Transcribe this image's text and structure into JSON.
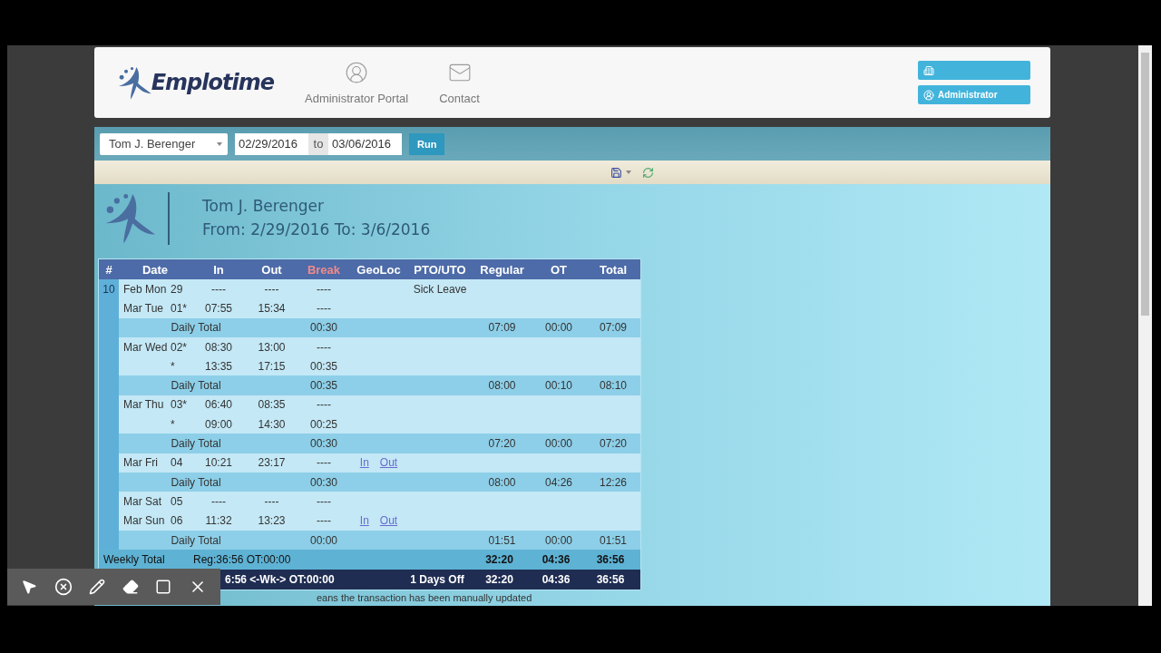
{
  "header": {
    "logo": "Emplotime",
    "nav": [
      {
        "label": "Administrator Portal"
      },
      {
        "label": "Contact"
      }
    ],
    "account_button": "Administrator"
  },
  "filter": {
    "employee": "Tom J. Berenger",
    "from": "02/29/2016",
    "to_label": "to",
    "to": "03/06/2016",
    "run": "Run"
  },
  "report": {
    "employee": "Tom J. Berenger",
    "range": "From: 2/29/2016 To: 3/6/2016"
  },
  "table": {
    "columns": [
      {
        "label": "#",
        "highlight": false
      },
      {
        "label": "Date",
        "highlight": false
      },
      {
        "label": "In",
        "highlight": false
      },
      {
        "label": "Out",
        "highlight": false
      },
      {
        "label": "Break",
        "highlight": true
      },
      {
        "label": "GeoLoc",
        "highlight": false
      },
      {
        "label": "PTO/UTO",
        "highlight": false
      },
      {
        "label": "Regular",
        "highlight": false
      },
      {
        "label": "OT",
        "highlight": false
      },
      {
        "label": "Total",
        "highlight": false
      }
    ],
    "week": "10",
    "rows": [
      {
        "kind": "day",
        "month_day": "Feb Mon",
        "day": "29",
        "in": "----",
        "out": "----",
        "break": "----",
        "pto": "Sick Leave"
      },
      {
        "kind": "day",
        "month_day": "Mar Tue",
        "day": "01*",
        "in": "07:55",
        "out": "15:34",
        "break": "----"
      },
      {
        "kind": "total",
        "label": "Daily Total",
        "break": "00:30",
        "regular": "07:09",
        "ot": "00:00",
        "total": "07:09"
      },
      {
        "kind": "day",
        "month_day": "Mar Wed",
        "day": "02*",
        "in": "08:30",
        "out": "13:00",
        "break": "----"
      },
      {
        "kind": "day",
        "day": "*",
        "in": "13:35",
        "out": "17:15",
        "break": "00:35"
      },
      {
        "kind": "total",
        "label": "Daily Total",
        "break": "00:35",
        "regular": "08:00",
        "ot": "00:10",
        "total": "08:10"
      },
      {
        "kind": "day",
        "month_day": "Mar Thu",
        "day": "03*",
        "in": "06:40",
        "out": "08:35",
        "break": "----"
      },
      {
        "kind": "day",
        "day": "*",
        "in": "09:00",
        "out": "14:30",
        "break": "00:25"
      },
      {
        "kind": "total",
        "label": "Daily Total",
        "break": "00:30",
        "regular": "07:20",
        "ot": "00:00",
        "total": "07:20"
      },
      {
        "kind": "day",
        "month_day": "Mar Fri",
        "day": "04",
        "in": "10:21",
        "out": "23:17",
        "break": "----",
        "geo": [
          "In",
          "Out"
        ]
      },
      {
        "kind": "total",
        "label": "Daily Total",
        "break": "00:30",
        "regular": "08:00",
        "ot": "04:26",
        "total": "12:26"
      },
      {
        "kind": "day",
        "month_day": "Mar Sat",
        "day": "05",
        "in": "----",
        "out": "----",
        "break": "----"
      },
      {
        "kind": "day",
        "month_day": "Mar Sun",
        "day": "06",
        "in": "11:32",
        "out": "13:23",
        "break": "----",
        "geo": [
          "In",
          "Out"
        ]
      },
      {
        "kind": "total",
        "label": "Daily Total",
        "break": "00:00",
        "regular": "01:51",
        "ot": "00:00",
        "total": "01:51"
      }
    ],
    "summary": [
      {
        "kind": "weekly",
        "label": "Weekly Total",
        "text": "Reg:36:56 OT:00:00",
        "regular": "32:20",
        "ot": "04:36",
        "total": "36:56"
      },
      {
        "kind": "grand",
        "text": "6:56 <-Wk-> OT:00:00",
        "pto": "1 Days Off",
        "regular": "32:20",
        "ot": "04:36",
        "total": "36:56"
      }
    ]
  },
  "footnote": "eans the transaction has been manually updated",
  "recorder_toolbar": [
    {
      "kind": "pointer"
    },
    {
      "kind": "blocked"
    },
    {
      "kind": "pen"
    },
    {
      "kind": "eraser"
    },
    {
      "kind": "rectangle"
    },
    {
      "kind": "close"
    }
  ]
}
